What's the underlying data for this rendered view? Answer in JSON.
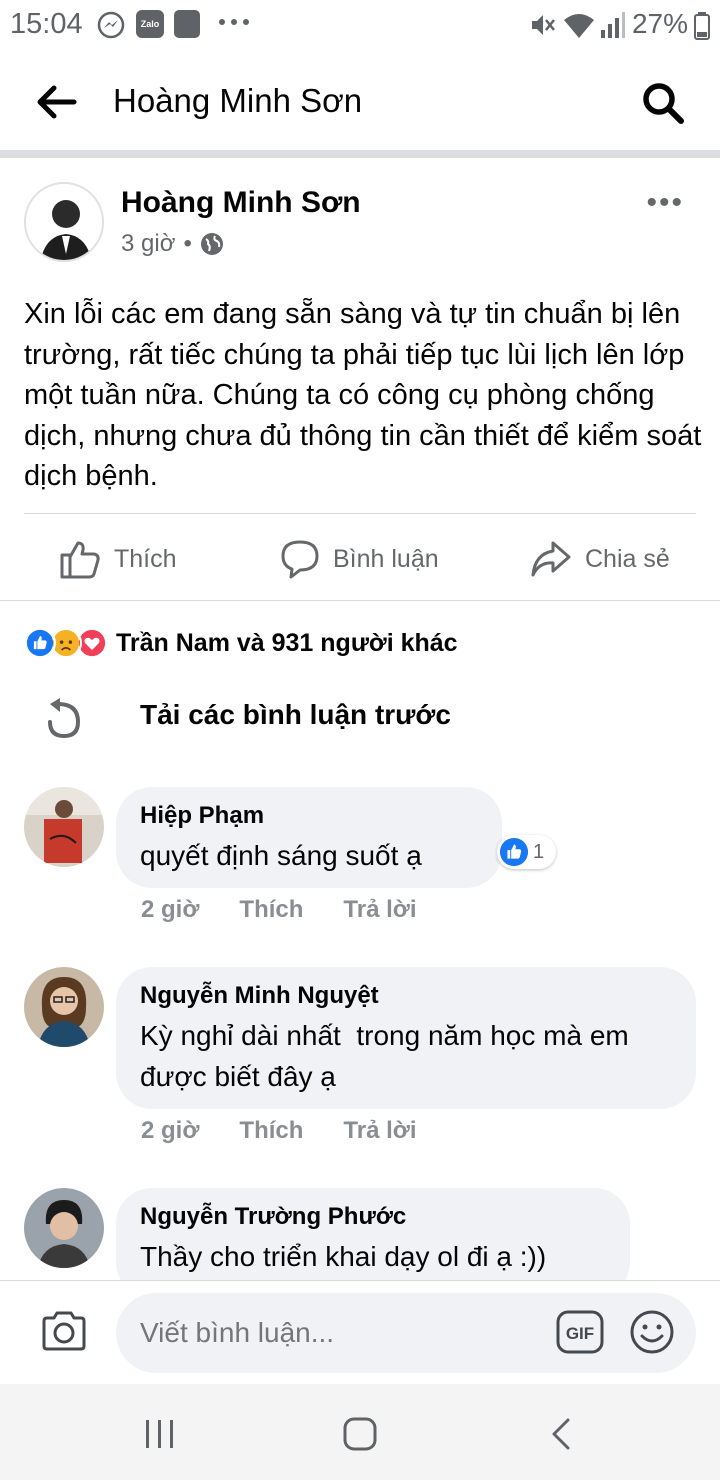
{
  "status_bar": {
    "time": "15:04",
    "battery": "27%",
    "app_icons": [
      "messenger-icon",
      "zalo-icon",
      "baomoi-icon",
      "more-dots-icon"
    ],
    "zalo_label": "Zalo",
    "right_icons": [
      "mute-icon",
      "wifi-icon",
      "signal-icon"
    ]
  },
  "header": {
    "title": "Hoàng Minh Sơn"
  },
  "post": {
    "author": "Hoàng Minh Sơn",
    "time": "3 giờ",
    "separator": "•",
    "privacy_icon": "globe-icon",
    "text": "Xin lỗi các em đang sẵn sàng và tự tin chuẩn bị lên trường, rất tiếc chúng ta phải tiếp tục lùi lịch lên lớp một tuần nữa. Chúng ta có công cụ phòng chống dịch, nhưng chưa đủ thông tin cần thiết để kiểm soát dịch bệnh.",
    "actions": {
      "like": "Thích",
      "comment": "Bình luận",
      "share": "Chia sẻ"
    }
  },
  "reactions": {
    "icons": [
      "like-reaction-icon",
      "sad-reaction-icon",
      "love-reaction-icon"
    ],
    "summary": "Trần Nam và 931 người khác"
  },
  "load_previous": "Tải các bình luận trước",
  "comments": [
    {
      "author": "Hiệp Phạm",
      "text": "quyết định sáng suốt ạ",
      "time": "2 giờ",
      "like": "Thích",
      "reply": "Trả lời",
      "like_count": "1"
    },
    {
      "author": "Nguyễn Minh Nguyệt",
      "text": "Kỳ nghỉ dài nhất  trong năm học mà em được biết đây ạ",
      "time": "2 giờ",
      "like": "Thích",
      "reply": "Trả lời"
    },
    {
      "author": "Nguyễn Trường Phước",
      "text": "Thầy cho triển khai dạy ol đi ạ :))"
    }
  ],
  "composer": {
    "placeholder": "Viết bình luận...",
    "gif_label": "GIF"
  },
  "colors": {
    "facebook_blue": "#1877f2",
    "secondary_text": "#65676b",
    "bubble_bg": "#f0f2f5",
    "love_red": "#f33e58",
    "sad_yellow": "#f7b125"
  }
}
